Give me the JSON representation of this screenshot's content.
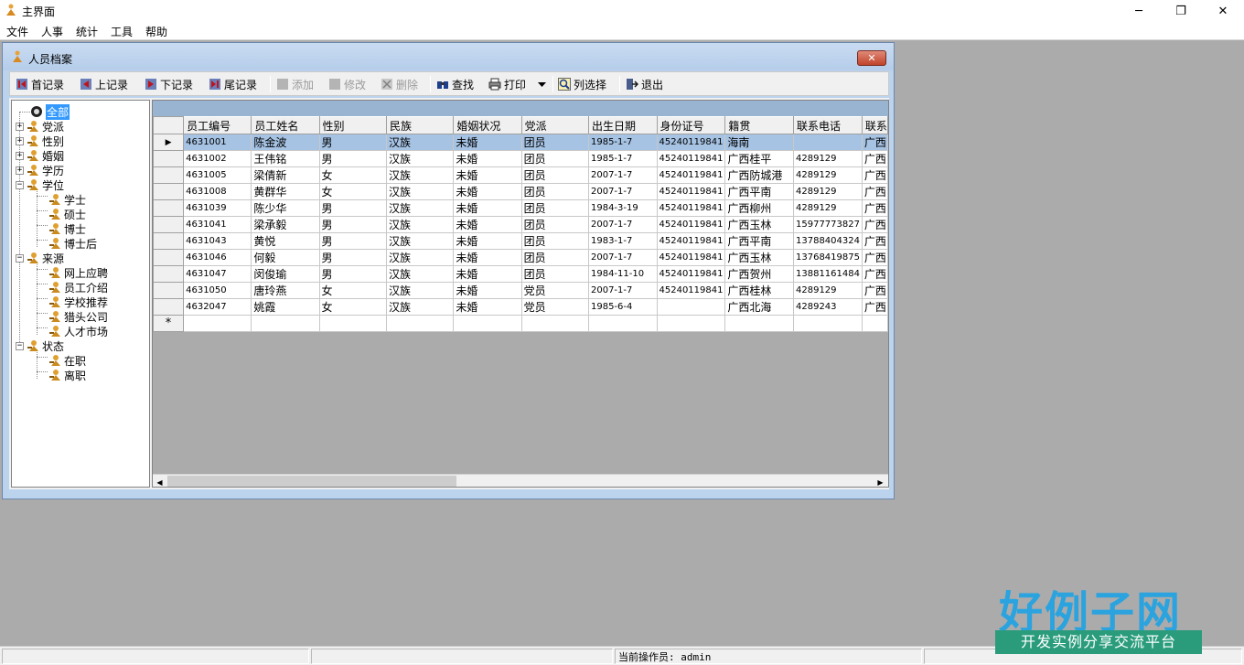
{
  "app": {
    "title": "主界面"
  },
  "menu": [
    "文件",
    "人事",
    "统计",
    "工具",
    "帮助"
  ],
  "window_controls": {
    "minimize": "─",
    "restore": "❐",
    "close": "✕"
  },
  "child_window": {
    "title": "人员档案",
    "close": "✕"
  },
  "toolbar": {
    "first": "首记录",
    "prev": "上记录",
    "next": "下记录",
    "last": "尾记录",
    "add": "添加",
    "edit": "修改",
    "delete": "删除",
    "find": "查找",
    "print": "打印",
    "columns": "列选择",
    "exit": "退出"
  },
  "tree": {
    "root": "全部",
    "party": "党派",
    "gender": "性别",
    "marriage": "婚姻",
    "education": "学历",
    "degree": "学位",
    "degree_items": [
      "学士",
      "硕士",
      "博士",
      "博士后"
    ],
    "source": "来源",
    "source_items": [
      "网上应聘",
      "员工介绍",
      "学校推荐",
      "猎头公司",
      "人才市场"
    ],
    "status": "状态",
    "status_items": [
      "在职",
      "离职"
    ]
  },
  "grid": {
    "columns": [
      "员工编号",
      "员工姓名",
      "性别",
      "民族",
      "婚姻状况",
      "党派",
      "出生日期",
      "身份证号",
      "籍贯",
      "联系电话",
      "联系"
    ],
    "rows": [
      [
        "4631001",
        "陈金波",
        "男",
        "汉族",
        "未婚",
        "团员",
        "1985-1-7",
        "45240119841",
        "海南",
        "",
        "广西"
      ],
      [
        "4631002",
        "王伟铭",
        "男",
        "汉族",
        "未婚",
        "团员",
        "1985-1-7",
        "45240119841",
        "广西桂平",
        "4289129",
        "广西"
      ],
      [
        "4631005",
        "梁倩新",
        "女",
        "汉族",
        "未婚",
        "团员",
        "2007-1-7",
        "45240119841",
        "广西防城港",
        "4289129",
        "广西"
      ],
      [
        "4631008",
        "黄群华",
        "女",
        "汉族",
        "未婚",
        "团员",
        "2007-1-7",
        "45240119841",
        "广西平南",
        "4289129",
        "广西"
      ],
      [
        "4631039",
        "陈少华",
        "男",
        "汉族",
        "未婚",
        "团员",
        "1984-3-19",
        "45240119841",
        "广西柳州",
        "4289129",
        "广西"
      ],
      [
        "4631041",
        "梁承毅",
        "男",
        "汉族",
        "未婚",
        "团员",
        "2007-1-7",
        "45240119841",
        "广西玉林",
        "15977773827",
        "广西"
      ],
      [
        "4631043",
        "黄悦",
        "男",
        "汉族",
        "未婚",
        "团员",
        "1983-1-7",
        "45240119841",
        "广西平南",
        "13788404324",
        "广西"
      ],
      [
        "4631046",
        "何毅",
        "男",
        "汉族",
        "未婚",
        "团员",
        "2007-1-7",
        "45240119841",
        "广西玉林",
        "13768419875",
        "广西"
      ],
      [
        "4631047",
        "闵俊瑜",
        "男",
        "汉族",
        "未婚",
        "团员",
        "1984-11-10",
        "45240119841",
        "广西贺州",
        "13881161484",
        "广西"
      ],
      [
        "4631050",
        "唐玲燕",
        "女",
        "汉族",
        "未婚",
        "党员",
        "2007-1-7",
        "45240119841",
        "广西桂林",
        "4289129",
        "广西"
      ],
      [
        "4632047",
        "姚霞",
        "女",
        "汉族",
        "未婚",
        "党员",
        "1985-6-4",
        "",
        "广西北海",
        "4289243",
        "广西"
      ]
    ],
    "current_marker": "▶",
    "new_marker": "*"
  },
  "status": {
    "operator": "当前操作员: admin"
  },
  "watermark": {
    "main": "好例子网",
    "sub": "开发实例分享交流平台"
  }
}
